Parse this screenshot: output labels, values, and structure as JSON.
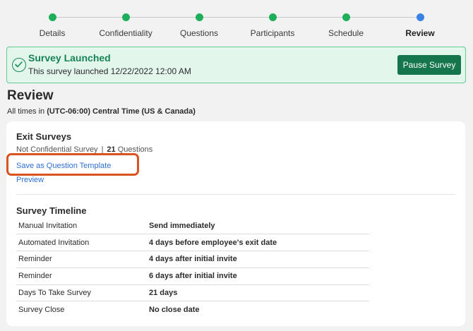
{
  "stepper": {
    "steps": [
      {
        "label": "Details",
        "state": "complete"
      },
      {
        "label": "Confidentiality",
        "state": "complete"
      },
      {
        "label": "Questions",
        "state": "complete"
      },
      {
        "label": "Participants",
        "state": "complete"
      },
      {
        "label": "Schedule",
        "state": "complete"
      },
      {
        "label": "Review",
        "state": "current"
      }
    ],
    "colors": {
      "complete": "#1fae5b",
      "current": "#3b82e6"
    }
  },
  "banner": {
    "title": "Survey Launched",
    "message": "This survey launched 12/22/2022 12:00 AM",
    "pause_label": "Pause Survey",
    "icon": "check-circle-icon"
  },
  "page": {
    "title": "Review",
    "timezone_prefix": "All times in",
    "timezone": "(UTC-06:00) Central Time (US & Canada)"
  },
  "survey": {
    "name": "Exit Surveys",
    "confidentiality": "Not Confidential Survey",
    "separator": "|",
    "question_count": "21",
    "question_label": "Questions",
    "save_template_label": "Save as Question Template",
    "preview_label": "Preview"
  },
  "timeline": {
    "title": "Survey Timeline",
    "rows": [
      {
        "label": "Manual Invitation",
        "value": "Send immediately"
      },
      {
        "label": "Automated Invitation",
        "value": "4 days before employee's exit date"
      },
      {
        "label": "Reminder",
        "value": "4 days after initial invite"
      },
      {
        "label": "Reminder",
        "value": "6 days after initial invite"
      },
      {
        "label": "Days To Take Survey",
        "value": "21 days"
      },
      {
        "label": "Survey Close",
        "value": "No close date"
      }
    ]
  },
  "accent_colors": {
    "brand_green": "#14764a",
    "link_blue": "#2f6fd1",
    "highlight_orange": "#d9531e"
  }
}
